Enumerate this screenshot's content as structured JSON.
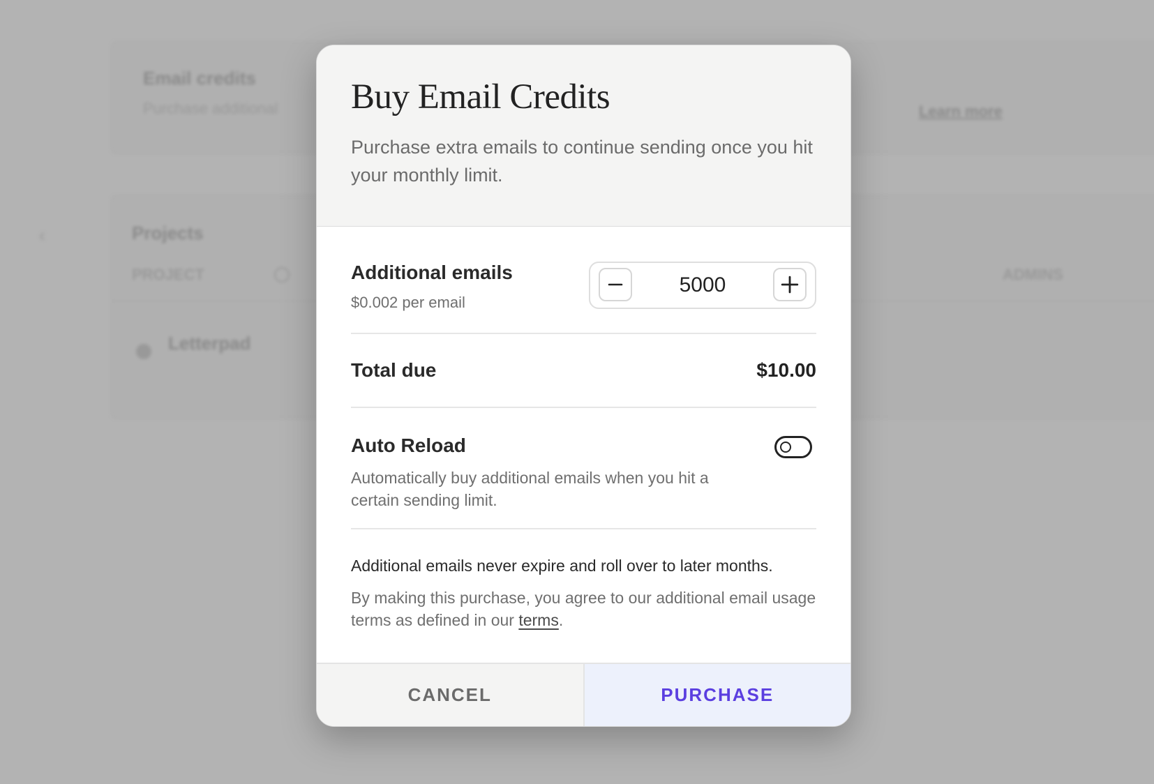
{
  "background": {
    "card1_title": "Email credits",
    "card1_subtitle": "Purchase additional",
    "card1_link": "Learn more",
    "card2_title": "Projects",
    "card2_col1": "PROJECT",
    "card2_col2": "ADMINS",
    "row_name": "Letterpad"
  },
  "modal": {
    "title": "Buy Email Credits",
    "description": "Purchase extra emails to continue sending once you hit your monthly limit.",
    "emails": {
      "label": "Additional emails",
      "price": "$0.002 per email",
      "quantity": "5000"
    },
    "total": {
      "label": "Total due",
      "value": "$10.00"
    },
    "auto_reload": {
      "label": "Auto Reload",
      "description": "Automatically buy additional emails when you hit a certain sending limit.",
      "enabled": false
    },
    "note": "Additional emails never expire and roll over to later months.",
    "agreement_prefix": "By making this purchase, you agree to our additional email usage terms as defined in our ",
    "agreement_link": "terms",
    "agreement_suffix": ".",
    "cancel_label": "CANCEL",
    "purchase_label": "PURCHASE"
  },
  "colors": {
    "accent": "#5b3fe0",
    "purchase_bg": "#edf1fc",
    "overlay": "#b3b3b3"
  },
  "icons": {
    "minus": "minus-icon",
    "plus": "plus-icon"
  }
}
